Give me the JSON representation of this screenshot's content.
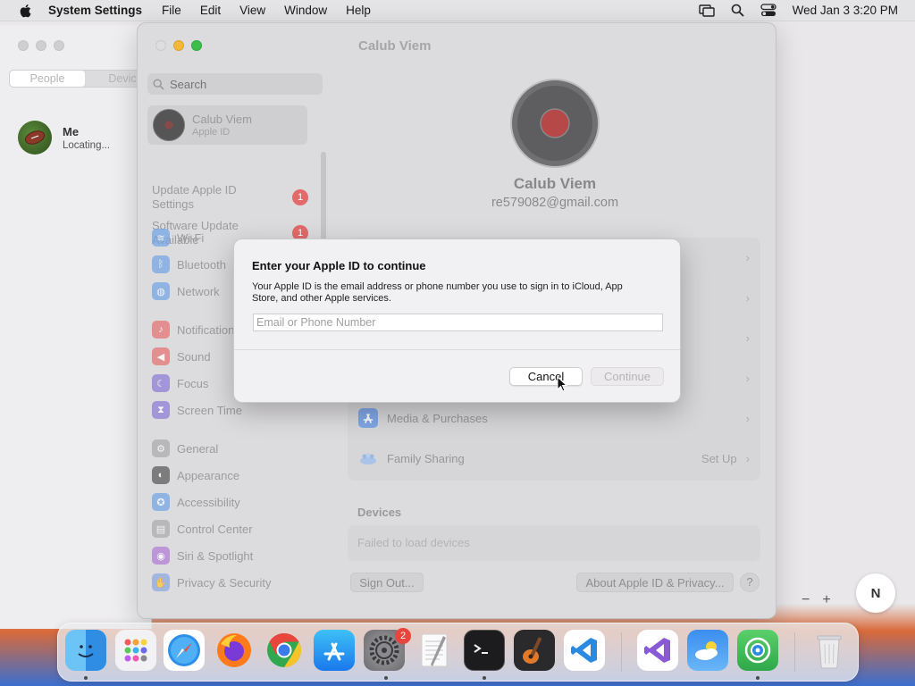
{
  "menubar": {
    "app_name": "System Settings",
    "menus": [
      "File",
      "Edit",
      "View",
      "Window",
      "Help"
    ],
    "clock": "Wed Jan 3  3:20 PM"
  },
  "people_window": {
    "segments": [
      "People",
      "Devic"
    ],
    "me": {
      "name": "Me",
      "status": "Locating..."
    }
  },
  "settings": {
    "window_title": "Calub Viem",
    "search_placeholder": "Search",
    "account": {
      "name": "Calub Viem",
      "subtitle": "Apple ID"
    },
    "notices": [
      {
        "label": "Update Apple ID Settings",
        "badge": "1"
      },
      {
        "label": "Software Update Available",
        "badge": "1"
      }
    ],
    "sidebar_items": [
      {
        "label": "Wi-Fi",
        "icon": "wifi-icon",
        "color": "#6fa3e6"
      },
      {
        "label": "Bluetooth",
        "icon": "bluetooth-icon",
        "color": "#6fa3e6"
      },
      {
        "label": "Network",
        "icon": "globe-icon",
        "color": "#6fa3e6"
      },
      {
        "label": "Notifications",
        "icon": "bell-icon",
        "color": "#e67070"
      },
      {
        "label": "Sound",
        "icon": "speaker-icon",
        "color": "#e67070"
      },
      {
        "label": "Focus",
        "icon": "moon-icon",
        "color": "#8b7ad6"
      },
      {
        "label": "Screen Time",
        "icon": "hourglass-icon",
        "color": "#8b7ad6"
      },
      {
        "label": "General",
        "icon": "gear-icon",
        "color": "#a9a8ab"
      },
      {
        "label": "Appearance",
        "icon": "appearance-icon",
        "color": "#555555"
      },
      {
        "label": "Accessibility",
        "icon": "accessibility-icon",
        "color": "#6fa3e6"
      },
      {
        "label": "Control Center",
        "icon": "control-center-icon",
        "color": "#a9a8ab"
      },
      {
        "label": "Siri & Spotlight",
        "icon": "siri-icon",
        "color": "#b07ad6"
      },
      {
        "label": "Privacy & Security",
        "icon": "hand-icon",
        "color": "#8aa6e0"
      }
    ],
    "profile": {
      "name": "Calub Viem",
      "email": "re579082@gmail.com"
    },
    "rows": [
      {
        "label": "Media & Purchases",
        "icon": "app-store-icon"
      },
      {
        "label": "Family Sharing",
        "icon": "family-icon",
        "action": "Set Up"
      }
    ],
    "devices_title": "Devices",
    "devices_status": "Failed to load devices",
    "sign_out": "Sign Out...",
    "about_privacy": "About Apple ID & Privacy...",
    "help": "?"
  },
  "dialog": {
    "title": "Enter your Apple ID to continue",
    "description": "Your Apple ID is the email address or phone number you use to sign in to iCloud, App Store, and other Apple services.",
    "input_placeholder": "Email or Phone Number",
    "input_value": "",
    "cancel": "Cancel",
    "continue": "Continue"
  },
  "map_controls": {
    "zoom_out": "−",
    "zoom_in": "+",
    "compass": "N"
  },
  "dock": {
    "apps": [
      "Finder",
      "Launchpad",
      "Safari",
      "Firefox",
      "Chrome",
      "App Store",
      "System Settings",
      "TextEdit",
      "Terminal",
      "GarageBand",
      "VS Code",
      "Visual Studio",
      "Weather",
      "Find My",
      "Trash"
    ],
    "system_settings_badge": "2"
  }
}
